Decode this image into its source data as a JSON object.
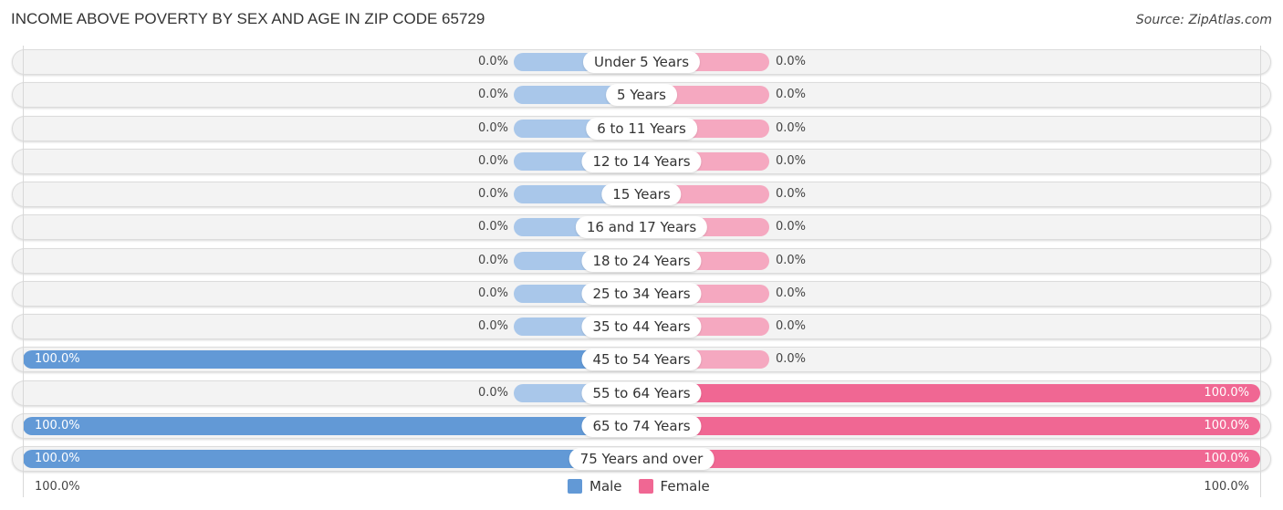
{
  "title": "INCOME ABOVE POVERTY BY SEX AND AGE IN ZIP CODE 65729",
  "source": "Source: ZipAtlas.com",
  "colors": {
    "male_full": "#6299d6",
    "male_stub": "#a9c7ea",
    "female_full": "#f06793",
    "female_stub": "#f5a8c0",
    "track": "#f3f3f3"
  },
  "axis": {
    "left_label": "100.0%",
    "right_label": "100.0%"
  },
  "legend": [
    {
      "name": "Male",
      "color": "#6299d6"
    },
    {
      "name": "Female",
      "color": "#f06793"
    }
  ],
  "chart_data": {
    "type": "bar",
    "orientation": "horizontal-diverging",
    "title": "INCOME ABOVE POVERTY BY SEX AND AGE IN ZIP CODE 65729",
    "categories": [
      "Under 5 Years",
      "5 Years",
      "6 to 11 Years",
      "12 to 14 Years",
      "15 Years",
      "16 and 17 Years",
      "18 to 24 Years",
      "25 to 34 Years",
      "35 to 44 Years",
      "45 to 54 Years",
      "55 to 64 Years",
      "65 to 74 Years",
      "75 Years and over"
    ],
    "series": [
      {
        "name": "Male",
        "values": [
          0,
          0,
          0,
          0,
          0,
          0,
          0,
          0,
          0,
          100,
          0,
          100,
          100
        ],
        "labels": [
          "0.0%",
          "0.0%",
          "0.0%",
          "0.0%",
          "0.0%",
          "0.0%",
          "0.0%",
          "0.0%",
          "0.0%",
          "100.0%",
          "0.0%",
          "100.0%",
          "100.0%"
        ]
      },
      {
        "name": "Female",
        "values": [
          0,
          0,
          0,
          0,
          0,
          0,
          0,
          0,
          0,
          0,
          100,
          100,
          100
        ],
        "labels": [
          "0.0%",
          "0.0%",
          "0.0%",
          "0.0%",
          "0.0%",
          "0.0%",
          "0.0%",
          "0.0%",
          "0.0%",
          "0.0%",
          "100.0%",
          "100.0%",
          "100.0%"
        ]
      }
    ],
    "xlim": [
      0,
      100
    ],
    "xlabel_left": "100.0%",
    "xlabel_right": "100.0%",
    "legend_position": "bottom-center",
    "grid": false
  }
}
